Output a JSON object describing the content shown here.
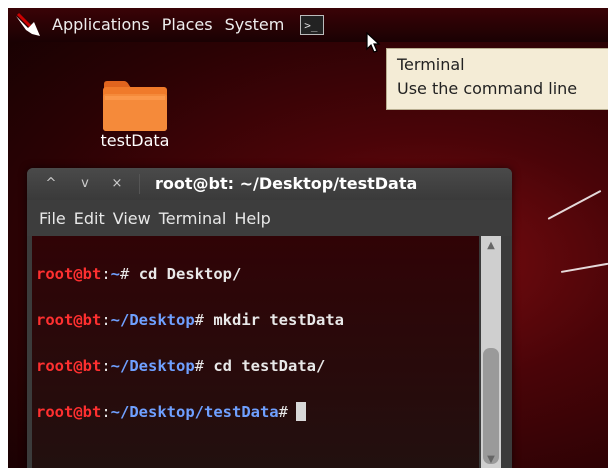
{
  "panel": {
    "menus": [
      "Applications",
      "Places",
      "System"
    ],
    "launcher_glyph": ">_"
  },
  "tooltip": {
    "title": "Terminal",
    "description": "Use the command line"
  },
  "desktop": {
    "icons": [
      {
        "label": "testData",
        "icon": "folder-icon"
      }
    ]
  },
  "terminal": {
    "title": "root@bt: ~/Desktop/testData",
    "title_buttons": [
      "^",
      "v",
      "×"
    ],
    "menus": [
      "File",
      "Edit",
      "View",
      "Terminal",
      "Help"
    ],
    "lines": [
      {
        "user": "root@bt",
        "sep": ":",
        "path": "~",
        "prompt": "#",
        "command": " cd Desktop/"
      },
      {
        "user": "root@bt",
        "sep": ":",
        "path": "~/Desktop",
        "prompt": "#",
        "command": " mkdir testData"
      },
      {
        "user": "root@bt",
        "sep": ":",
        "path": "~/Desktop",
        "prompt": "#",
        "command": " cd testData/"
      },
      {
        "user": "root@bt",
        "sep": ":",
        "path": "~/Desktop/testData",
        "prompt": "#",
        "command": ""
      }
    ]
  },
  "colors": {
    "user": "#ff3030",
    "path": "#6fa0ff",
    "desktop_bg": "#4a0408"
  }
}
